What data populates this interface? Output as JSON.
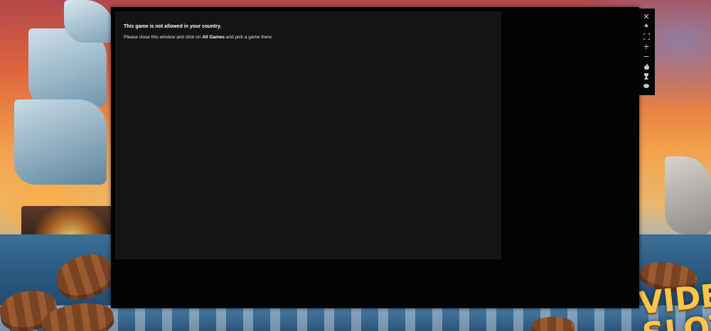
{
  "dialog": {
    "title": "This game is not allowed in your country.",
    "instruction_before": "Please close this window and click on ",
    "instruction_link": "All Games",
    "instruction_after": " and pick a game there."
  },
  "toolbar": {
    "items": [
      {
        "name": "close-icon",
        "glyph": "✕"
      },
      {
        "name": "star-icon",
        "glyph": "★"
      },
      {
        "name": "fullscreen-icon",
        "glyph": ""
      },
      {
        "name": "zoom-in-icon",
        "glyph": "+"
      },
      {
        "name": "zoom-out-icon",
        "glyph": "−"
      },
      {
        "name": "flame-icon",
        "glyph": "♨"
      },
      {
        "name": "trophy-icon",
        "glyph": "🏆"
      },
      {
        "name": "eye-icon",
        "glyph": "●"
      }
    ]
  },
  "colors": {
    "window_bg": "#030303",
    "frame_bg": "#141414",
    "text": "#ffffff",
    "icon": "#c9c9c9"
  }
}
